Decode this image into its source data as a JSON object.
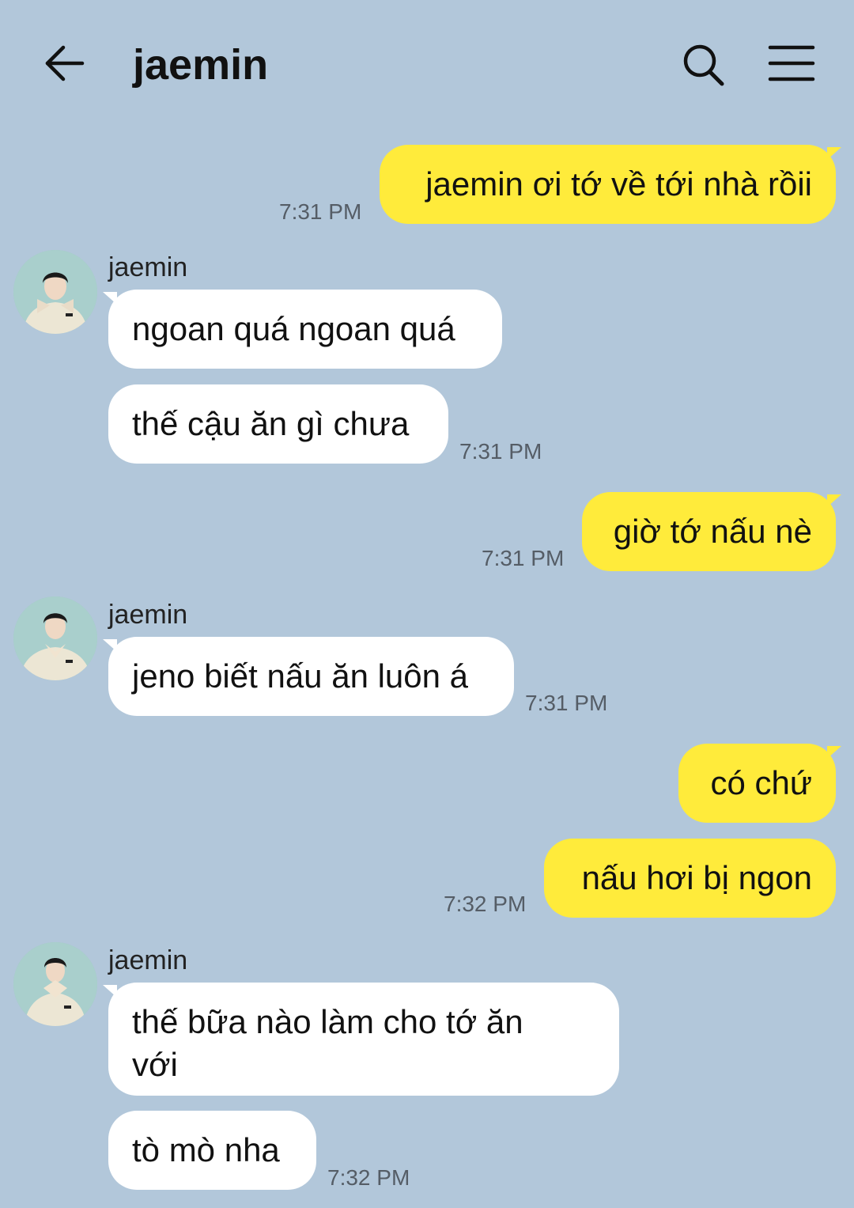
{
  "header": {
    "title": "jaemin",
    "back_icon": "back-arrow-icon",
    "search_icon": "search-icon",
    "menu_icon": "menu-icon"
  },
  "colors": {
    "background": "#b2c7da",
    "my_bubble": "#ffeb3b",
    "their_bubble": "#ffffff"
  },
  "messages": [
    {
      "from": "me",
      "text": "jaemin ơi tớ về tới nhà rồii",
      "time": "7:31 PM"
    },
    {
      "from": "jaemin",
      "sender": "jaemin",
      "text": "ngoan quá ngoan quá"
    },
    {
      "from": "jaemin",
      "text": "thế cậu ăn gì chưa",
      "time": "7:31 PM"
    },
    {
      "from": "me",
      "text": "giờ tớ nấu nè",
      "time": "7:31 PM"
    },
    {
      "from": "jaemin",
      "sender": "jaemin",
      "text": "jeno biết nấu ăn luôn á",
      "time": "7:31 PM"
    },
    {
      "from": "me",
      "text": "có chứ"
    },
    {
      "from": "me",
      "text": "nấu hơi bị ngon",
      "time": "7:32 PM"
    },
    {
      "from": "jaemin",
      "sender": "jaemin",
      "text": "thế bữa nào làm cho tớ ăn với"
    },
    {
      "from": "jaemin",
      "text": "tò mò nha",
      "time": "7:32 PM"
    }
  ]
}
